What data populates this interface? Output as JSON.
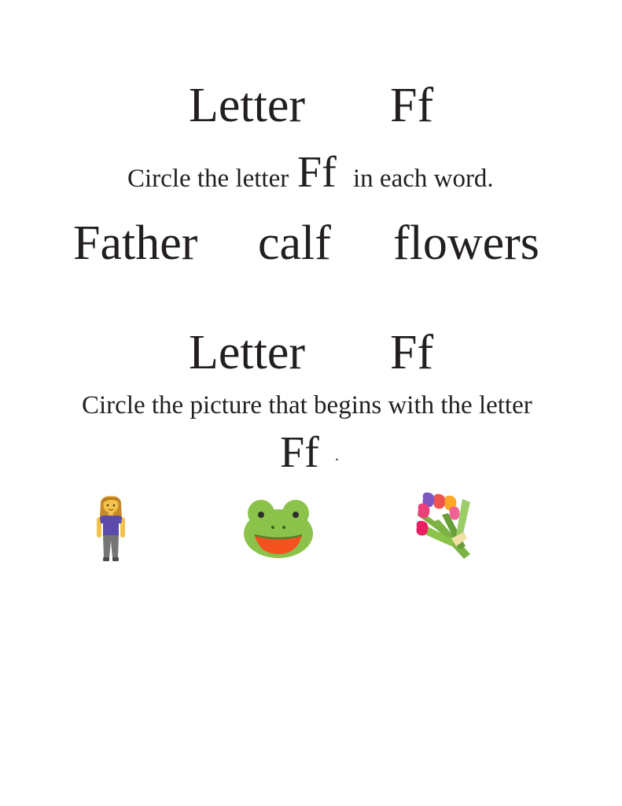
{
  "section1": {
    "title_word": "Letter",
    "title_letter": "Ff",
    "instruction_before": "Circle the letter",
    "instruction_letter": "Ff",
    "instruction_after": "in each word.",
    "words": [
      "Father",
      "calf",
      "flowers"
    ]
  },
  "section2": {
    "title_word": "Letter",
    "title_letter": "Ff",
    "instruction": "Circle the picture that begins with the letter",
    "letter": "Ff",
    "period": "."
  },
  "pictures": [
    {
      "icon": "woman-icon"
    },
    {
      "icon": "frog-icon"
    },
    {
      "icon": "bouquet-icon"
    }
  ]
}
